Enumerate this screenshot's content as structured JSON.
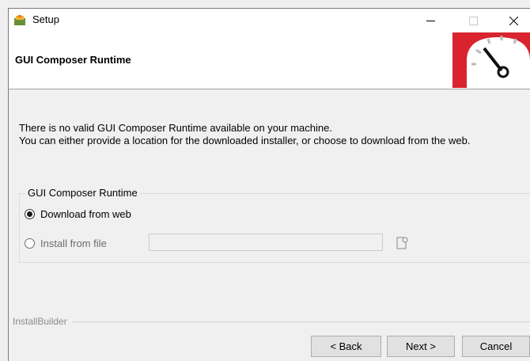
{
  "window": {
    "title": "Setup"
  },
  "header": {
    "title": "GUI Composer Runtime"
  },
  "body": {
    "line1": "There is no valid GUI Composer Runtime available on your machine.",
    "line2": "You can either provide a location for the downloaded installer, or choose to download from the web."
  },
  "group": {
    "legend": "GUI Composer Runtime",
    "option_download": "Download from web",
    "option_file": "Install from file",
    "selected": "Download from web",
    "file_path": ""
  },
  "footer": {
    "brand": "InstallBuilder",
    "back_label": "< Back",
    "next_label": "Next >",
    "cancel_label": "Cancel"
  },
  "colors": {
    "logo_red": "#d9232e",
    "window_bg": "#f0f0f0"
  }
}
